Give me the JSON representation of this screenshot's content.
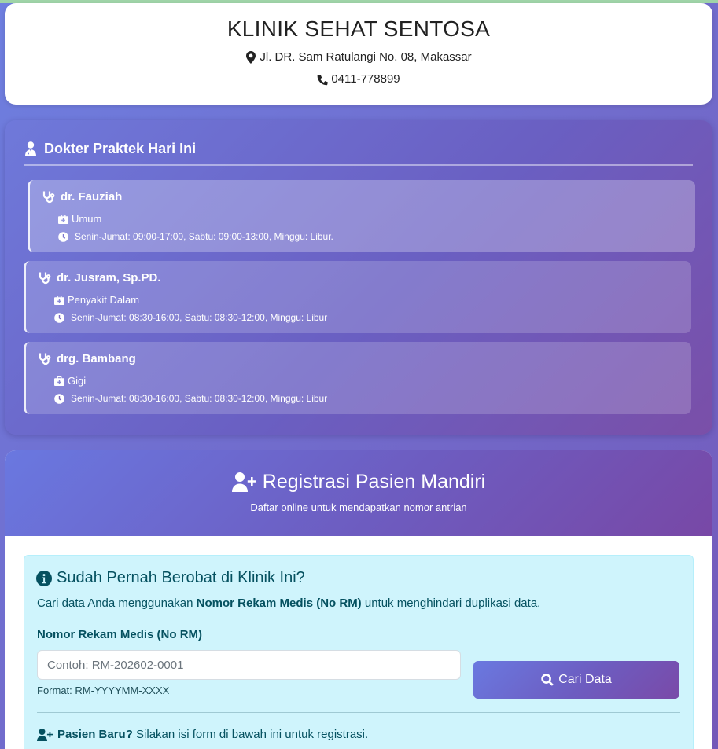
{
  "clinic": {
    "name": "KLINIK SEHAT SENTOSA",
    "address": "Jl. DR. Sam Ratulangi No. 08, Makassar",
    "phone": "0411-778899"
  },
  "doctors_section": {
    "title": "Dokter Praktek Hari Ini",
    "doctors": [
      {
        "name": "dr. Fauziah",
        "specialty": "Umum",
        "schedule": "Senin-Jumat: 09:00-17:00, Sabtu: 09:00-13:00, Minggu: Libur."
      },
      {
        "name": "dr. Jusram, Sp.PD.",
        "specialty": "Penyakit Dalam",
        "schedule": "Senin-Jumat: 08:30-16:00, Sabtu: 08:30-12:00, Minggu: Libur"
      },
      {
        "name": "drg. Bambang",
        "specialty": "Gigi",
        "schedule": "Senin-Jumat: 08:30-16:00, Sabtu: 08:30-12:00, Minggu: Libur"
      }
    ]
  },
  "registration": {
    "title": "Registrasi Pasien Mandiri",
    "subtitle": "Daftar online untuk mendapatkan nomor antrian",
    "returning": {
      "title": "Sudah Pernah Berobat di Klinik Ini?",
      "desc_prefix": "Cari data Anda menggunakan ",
      "desc_bold": "Nomor Rekam Medis (No RM)",
      "desc_suffix": " untuk menghindari duplikasi data.",
      "field_label": "Nomor Rekam Medis (No RM)",
      "input_placeholder": "Contoh: RM-202602-0001",
      "input_value": "",
      "hint": "Format: RM-YYYYMM-XXXX",
      "search_button": "Cari Data"
    },
    "new_patient": {
      "bold": "Pasien Baru?",
      "text": " Silakan isi form di bawah ini untuk registrasi."
    }
  },
  "colors": {
    "accent_start": "#6a79e0",
    "accent_end": "#7848a6",
    "alert_bg": "#cff4fc",
    "alert_text": "#055160"
  },
  "icons": {
    "address": "map-marker-icon",
    "phone": "phone-icon",
    "doctors_title": "user-doctor-icon",
    "doctor": "stethoscope-icon",
    "specialty": "briefcase-medical-icon",
    "schedule": "clock-icon",
    "registration": "user-plus-icon",
    "info": "info-circle-icon",
    "search": "search-icon"
  }
}
